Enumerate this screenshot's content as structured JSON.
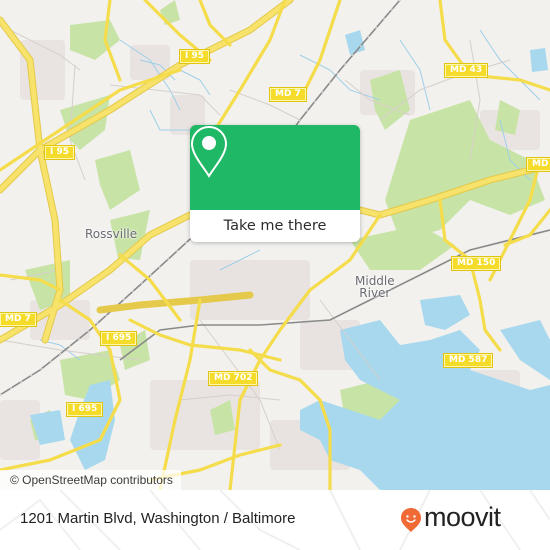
{
  "map": {
    "attribution": "© OpenStreetMap contributors",
    "place_labels": {
      "rossville": "Rossville",
      "middle_river_line1": "Middle",
      "middle_river_line2": "River"
    },
    "route_shields": {
      "i95_top": "I 95",
      "i95_left": "I 95",
      "md7_top": "MD 7",
      "md43": "MD 43",
      "md_right_edge": "MD",
      "md7_left": "MD 7",
      "i695_upper": "I 695",
      "i695_lower": "I 695",
      "md702": "MD 702",
      "md150": "MD 150",
      "md587": "MD 587"
    },
    "colors": {
      "land": "#f2f1ee",
      "park": "#c8e3a6",
      "water": "#a8d8ee",
      "road": "#f5dc4a",
      "rail": "#888888",
      "accent": "#1fb866"
    }
  },
  "popup": {
    "icon": "location-pin-icon",
    "button_label": "Take me there"
  },
  "footer": {
    "address": "1201 Martin Blvd, Washington / Baltimore",
    "brand": "moovit",
    "brand_color": "#f06a35"
  }
}
